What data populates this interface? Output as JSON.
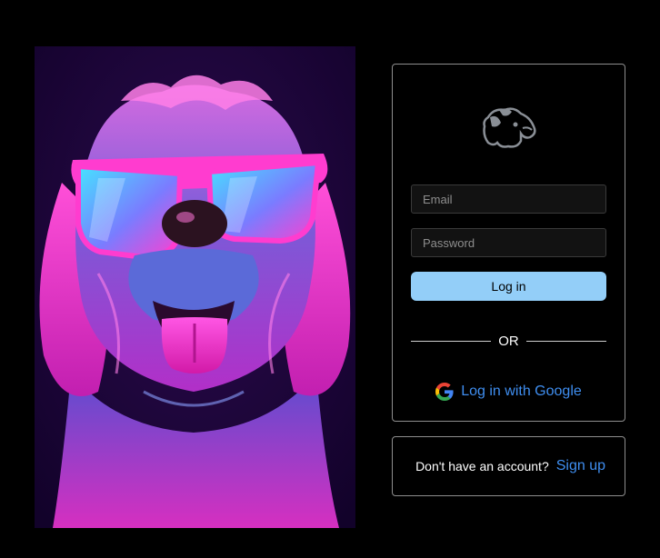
{
  "hero": {
    "alt": "dog-in-sunglasses-illustration"
  },
  "login": {
    "logo_icon": "dog-head-icon",
    "email_placeholder": "Email",
    "password_placeholder": "Password",
    "login_label": "Log in",
    "divider_text": "OR",
    "google_icon": "google-icon",
    "google_label": "Log in with Google"
  },
  "signup": {
    "question": "Don't have an account?",
    "link_label": "Sign up"
  },
  "colors": {
    "login_button": "#93cef8",
    "link": "#3f8ef0",
    "border": "#8e8e8e"
  }
}
